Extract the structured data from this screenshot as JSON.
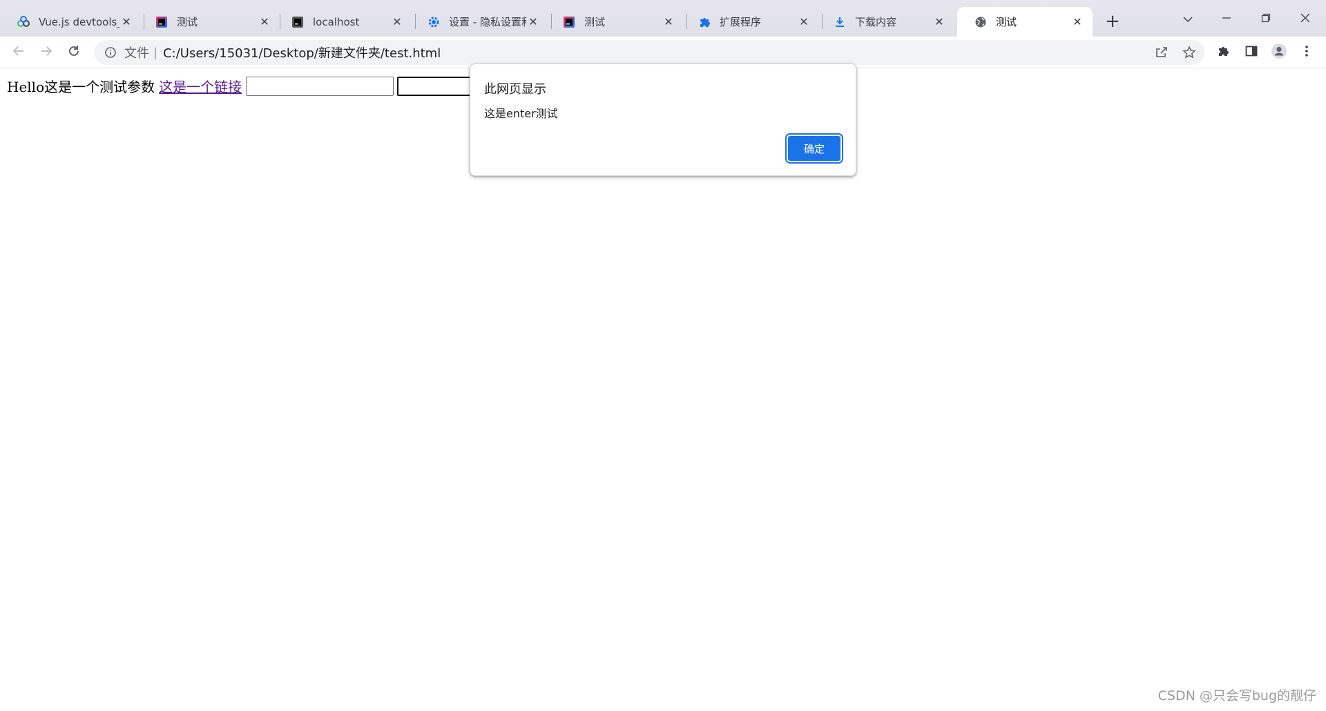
{
  "browser": {
    "tabs": [
      {
        "title": "Vue.js devtools_",
        "icon": "vue-icon",
        "active": false
      },
      {
        "title": "测试",
        "icon": "intellij-icon",
        "active": false
      },
      {
        "title": "localhost",
        "icon": "intellij-icon",
        "active": false
      },
      {
        "title": "设置 - 隐私设置和",
        "icon": "gear-icon",
        "active": false
      },
      {
        "title": "测试",
        "icon": "intellij-icon",
        "active": false
      },
      {
        "title": "扩展程序",
        "icon": "puzzle-icon",
        "active": false
      },
      {
        "title": "下载内容",
        "icon": "download-icon",
        "active": false
      },
      {
        "title": "测试",
        "icon": "globe-icon",
        "active": true
      }
    ],
    "new_tab_symbol": "+",
    "close_symbol": "✕"
  },
  "omnibox": {
    "scheme_label": "文件",
    "separator": "|",
    "url": "C:/Users/15031/Desktop/新建文件夹/test.html"
  },
  "page": {
    "text": "Hello这是一个测试参数",
    "link_text": "这是一个链接",
    "input1_value": "",
    "input2_value": ""
  },
  "dialog": {
    "title": "此网页显示",
    "message": "这是enter测试",
    "ok_label": "确定"
  },
  "watermark": "CSDN @只会写bug的靓仔",
  "colors": {
    "accent": "#1a73e8",
    "link_visited": "#551a8b",
    "tabstrip": "#dee1e6"
  }
}
